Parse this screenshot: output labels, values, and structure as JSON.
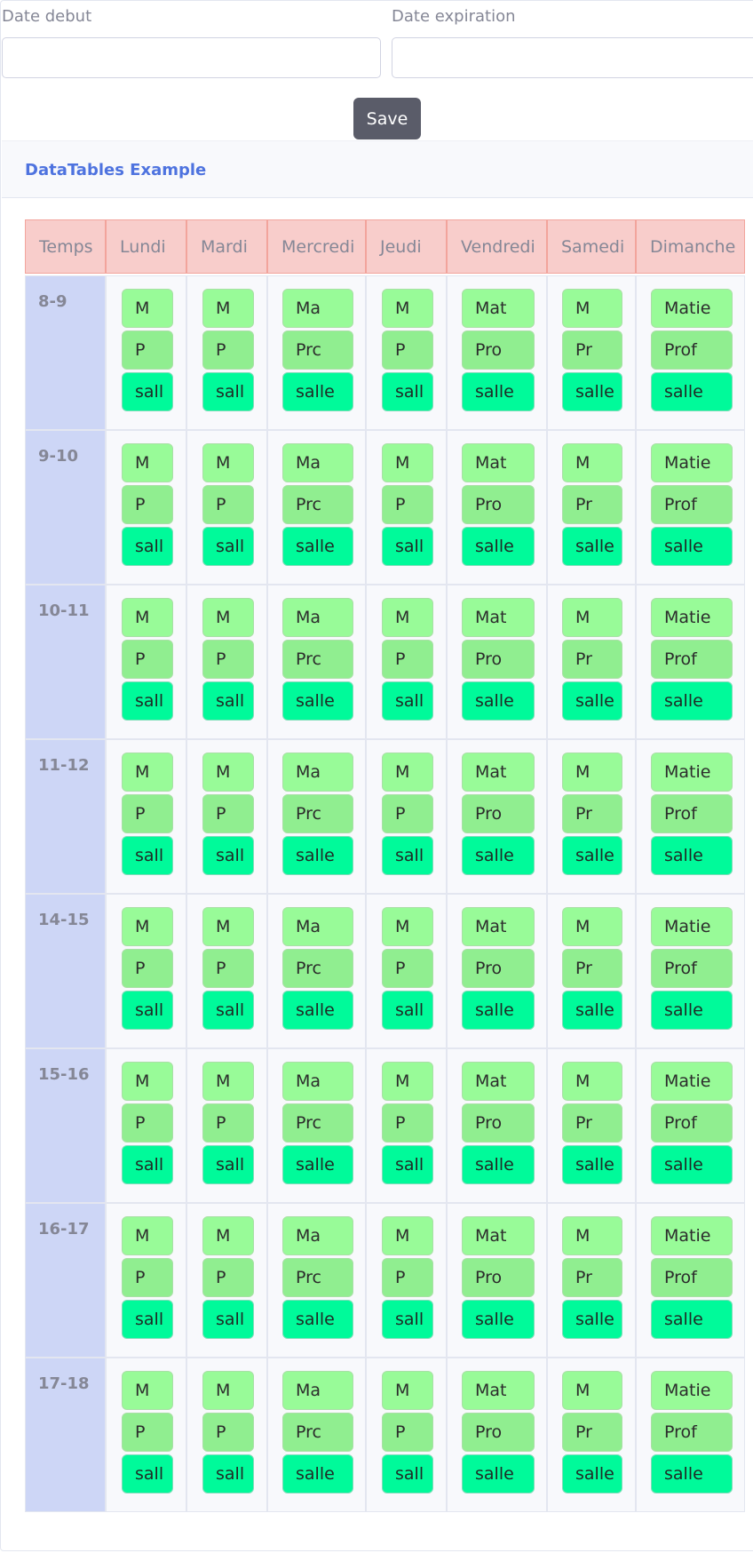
{
  "form": {
    "date_debut_label": "Date debut",
    "date_debut_value": "",
    "date_expiration_label": "Date expiration",
    "date_expiration_value": "",
    "save_label": "Save"
  },
  "card": {
    "title": "DataTables Example"
  },
  "table": {
    "corner_header": "Temps",
    "days": [
      "Lundi",
      "Mardi",
      "Mercredi",
      "Jeudi",
      "Vendredi",
      "Samedi",
      "Dimanche"
    ],
    "time_slots": [
      "8-9",
      "9-10",
      "10-11",
      "11-12",
      "14-15",
      "15-16",
      "16-17",
      "17-18"
    ],
    "cell_entries": {
      "matiere": [
        "M",
        "M",
        "Ma",
        "M",
        "Mat",
        "M",
        "Matie"
      ],
      "prof": [
        "P",
        "P",
        "Prc",
        "P",
        "Pro",
        "Pr",
        "Prof"
      ],
      "salle": [
        "sall",
        "sall",
        "salle",
        "sall",
        "salle",
        "salle",
        "salle"
      ]
    }
  },
  "colors": {
    "header_bg": "#f8cdcb",
    "time_bg": "#cdd6f6",
    "matiere_chip": "#98fb98",
    "prof_chip": "#90ee90",
    "salle_chip": "#00fa9a",
    "accent": "#4e73df"
  }
}
